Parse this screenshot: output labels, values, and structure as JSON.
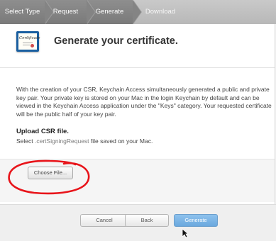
{
  "steps": [
    {
      "label": "Select Type"
    },
    {
      "label": "Request"
    },
    {
      "label": "Generate"
    },
    {
      "label": "Download"
    }
  ],
  "icon": {
    "name": "certificate-icon",
    "word": "Certificate"
  },
  "title": "Generate your certificate.",
  "description": "With the creation of your CSR, Keychain Access simultaneously generated a public and private key pair. Your private key is stored on your Mac in the login Keychain by default and can be viewed in the Keychain Access application under the \"Keys\" category. Your requested certificate will be the public half of your key pair.",
  "upload": {
    "title": "Upload CSR file.",
    "sub_prefix": "Select ",
    "sub_highlight": ".certSigningRequest",
    "sub_suffix": " file saved on your Mac.",
    "choose_label": "Choose File..."
  },
  "buttons": {
    "cancel": "Cancel",
    "back": "Back",
    "generate": "Generate"
  },
  "colors": {
    "annotation": "#e8141a",
    "primary_button": "#6aa8de"
  }
}
